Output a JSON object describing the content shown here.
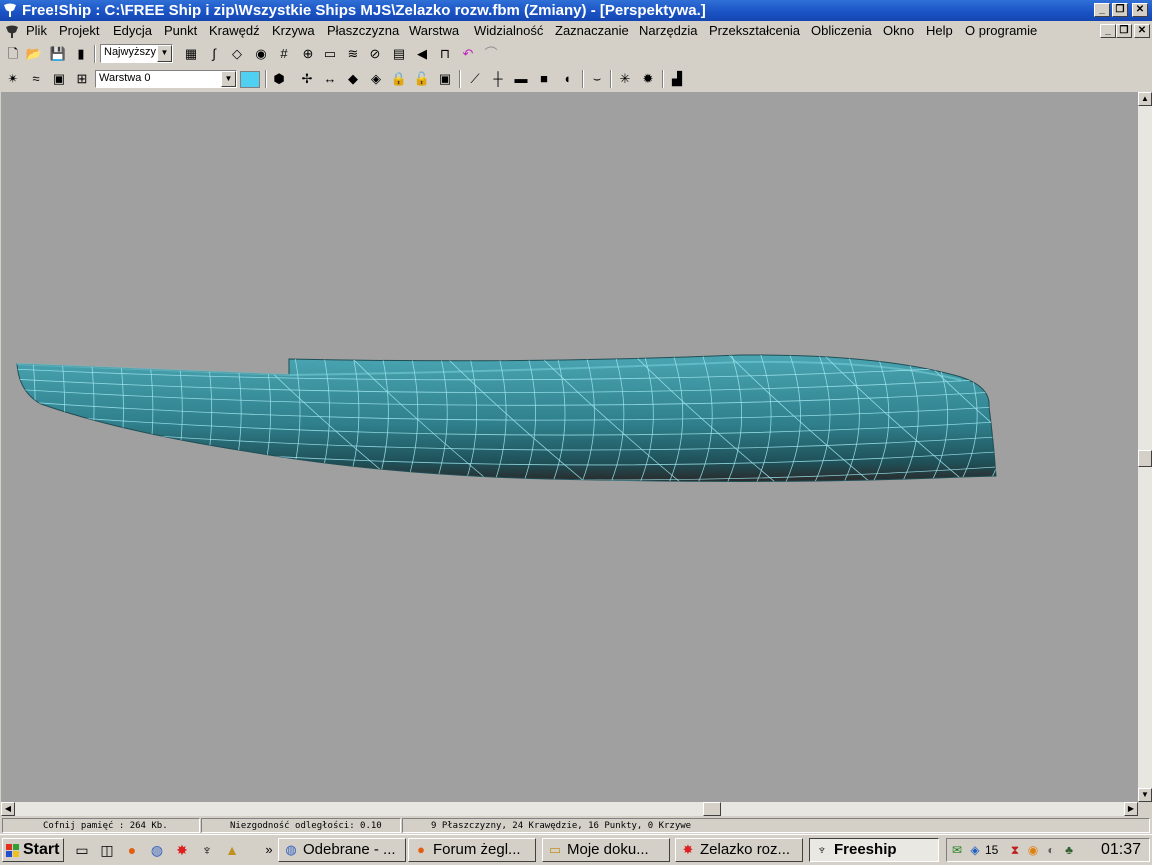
{
  "window": {
    "title": "Free!Ship  : C:\\FREE Ship i zip\\Wszystkie Ships MJS\\Zelazko rozw.fbm (Zmiany) - [Perspektywa.]",
    "minimize": "_",
    "maximize": "❐",
    "close": "✕"
  },
  "menu": [
    "Plik",
    "Projekt",
    "Edycja",
    "Punkt",
    "Krawędź",
    "Krzywa",
    "Płaszczyzna",
    "Warstwa",
    "Widzialność",
    "Zaznaczanie",
    "Narzędzia",
    "Przekształcenia",
    "Obliczenia",
    "Okno",
    "Help",
    "O programie"
  ],
  "toolbar": {
    "precision_value": "Najwyższy",
    "layer_value": "Warstwa 0",
    "layer_color": "#4fd0f0"
  },
  "status": {
    "undo_memory": "Cofnij pamięć : 264 Kb.",
    "distance_error": "Niezgodność odległości: 0.10",
    "counts": "9 Płaszczyzny, 24 Krawędzie, 16 Punkty, 0 Krzywe"
  },
  "taskbar": {
    "start": "Start",
    "overflow": "»",
    "tasks": [
      {
        "label": "Odebrane - ...",
        "icon": "thunderbird-icon"
      },
      {
        "label": "Forum żegl...",
        "icon": "firefox-icon"
      },
      {
        "label": "Moje doku...",
        "icon": "folder-icon"
      },
      {
        "label": "Zelazko roz...",
        "icon": "freeship-file-icon"
      },
      {
        "label": "Freeship",
        "icon": "freeship-icon"
      }
    ],
    "tray_number": "15",
    "clock": "01:37"
  },
  "colors": {
    "viewport_bg": "#a0a0a0",
    "hull": "#3a8e9a",
    "hull_dark": "#2a5e66",
    "mesh": "#9fe6f0",
    "title_bar": "#1a52c4"
  }
}
